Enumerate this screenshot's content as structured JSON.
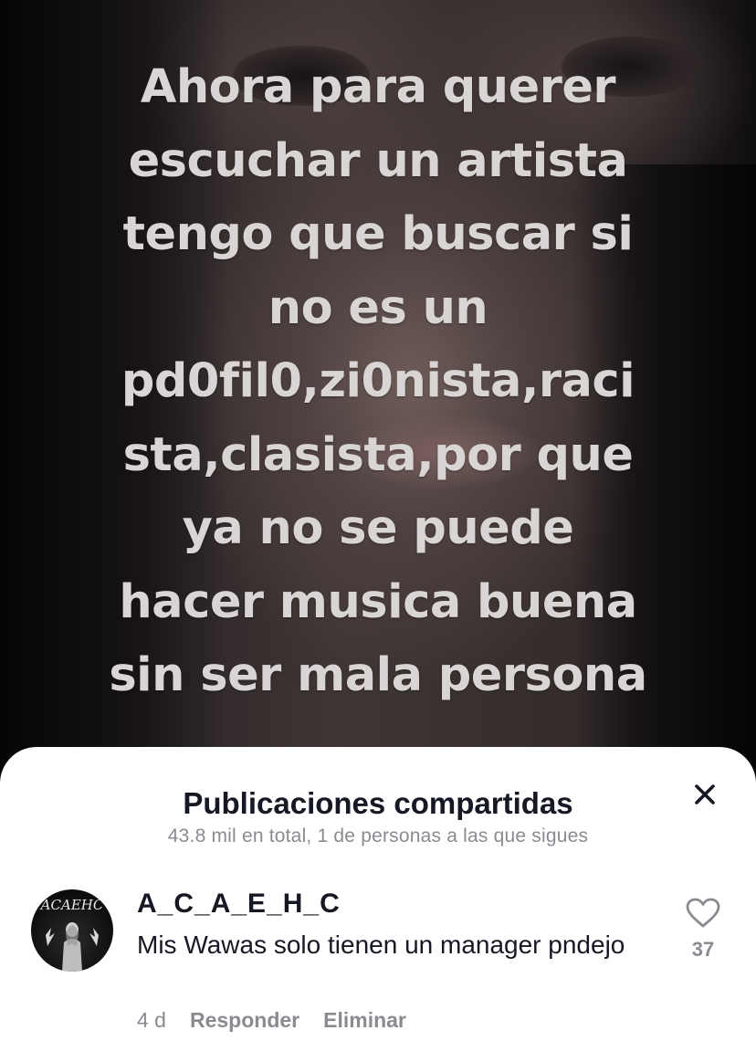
{
  "video": {
    "caption_lines": [
      "Ahora para querer",
      "escuchar un artista",
      "tengo que buscar si",
      "no es un",
      "pd0fil0,zi0nista,raci",
      "sta,clasista,por que",
      "ya no se puede",
      "hacer musica buena",
      "sin ser mala persona"
    ]
  },
  "sheet": {
    "title": "Publicaciones compartidas",
    "subtitle": "43.8 mil en total, 1 de personas a las que sigues",
    "close_icon": "close-icon"
  },
  "comment": {
    "avatar_icon": "avatar",
    "avatar_logo_text": "ACAEHC",
    "author": "A_C_A_E_H_C",
    "text": "Mis Wawas solo tienen un manager pndejo",
    "time": "4 d",
    "reply_label": "Responder",
    "delete_label": "Eliminar",
    "like_icon": "heart-outline-icon",
    "like_count": "37"
  },
  "colors": {
    "text_primary": "#161823",
    "text_secondary": "#8a8b91",
    "sheet_background": "#ffffff",
    "caption_text": "#d9d5d4"
  }
}
